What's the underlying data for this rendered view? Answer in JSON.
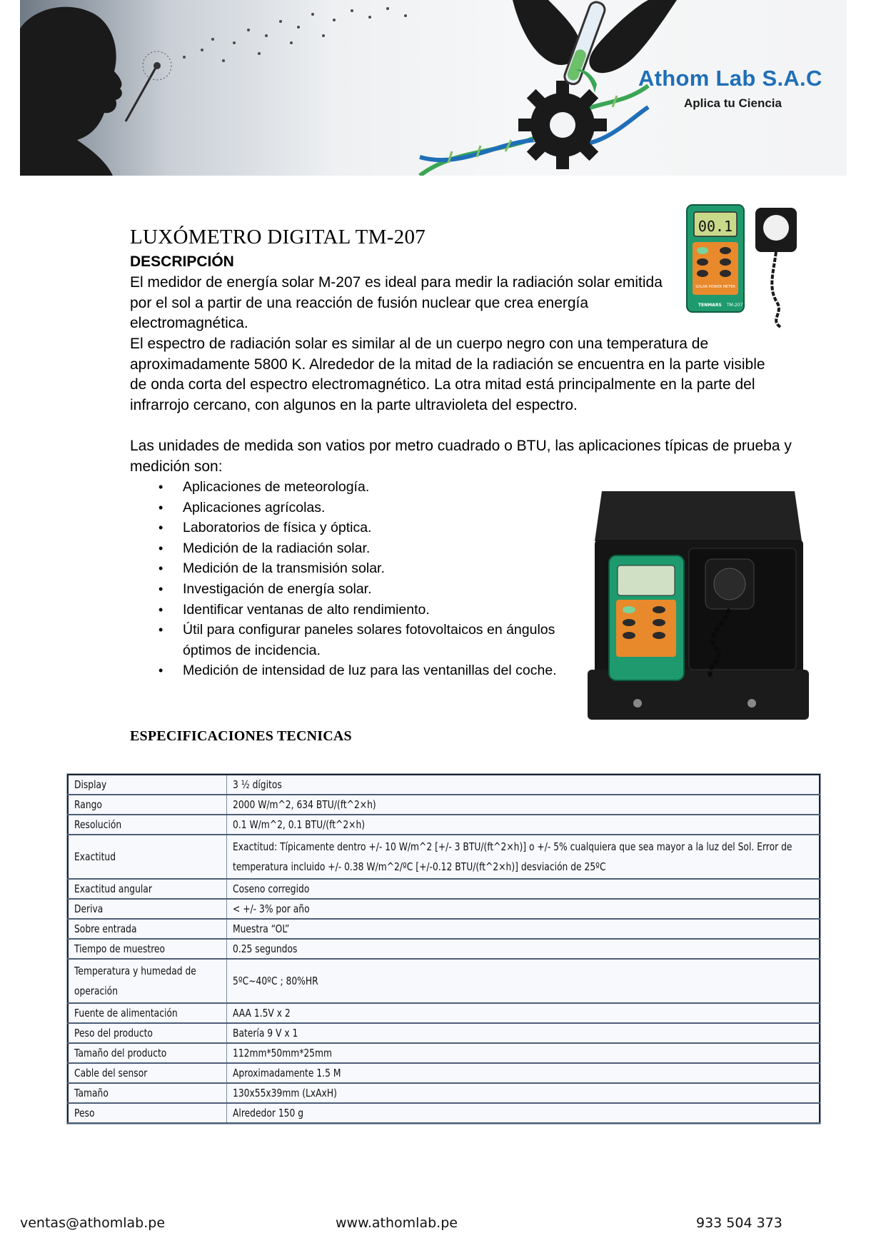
{
  "header": {
    "brand_name": "Athom Lab S.A.C",
    "slogan": "Aplica tu Ciencia"
  },
  "product": {
    "title": "LUXÓMETRO DIGITAL TM-207",
    "description_heading": "DESCRIPCIÓN",
    "paragraph_1": "El medidor de energía solar M-207 es ideal para medir la radiación solar emitida por el sol a partir de una reacción de fusión nuclear que crea energía electromagnética.",
    "paragraph_2": "El espectro de radiación solar es similar al de un cuerpo negro con una temperatura de aproximadamente 5800 K. Alrededor de la mitad de la radiación se encuentra en la parte visible de onda corta del espectro electromagnético. La otra mitad está principalmente en la parte del infrarrojo cercano, con algunos en la parte ultravioleta del espectro.",
    "paragraph_3": "Las unidades de medida son vatios por metro cuadrado o BTU, las aplicaciones típicas de prueba y medición son:",
    "applications": [
      "Aplicaciones de meteorología.",
      "Aplicaciones agrícolas.",
      "Laboratorios de física y óptica.",
      "Medición de la radiación solar.",
      "Medición de la transmisión solar.",
      "Investigación de energía solar.",
      "Identificar ventanas de alto rendimiento.",
      "Útil para configurar paneles solares fotovoltaicos en ángulos óptimos de incidencia.",
      "Medición de intensidad de luz para las ventanillas del coche."
    ],
    "meter_brand": "TENMARS",
    "meter_model": "TM-207",
    "meter_label": "SOLAR POWER METER",
    "display_reading": "00.1"
  },
  "specs": {
    "heading": "ESPECIFICACIONES TECNICAS",
    "rows": [
      {
        "key": "Display",
        "value": "3 ½ dígitos"
      },
      {
        "key": "Rango",
        "value": "2000 W/m^2, 634 BTU/(ft^2×h)"
      },
      {
        "key": "Resolución",
        "value": "0.1 W/m^2, 0.1 BTU/(ft^2×h)"
      },
      {
        "key": "Exactitud",
        "value": "Exactitud: Típicamente dentro +/- 10 W/m^2 [+/- 3 BTU/(ft^2×h)] o +/- 5% cualquiera que sea mayor a la luz del Sol. Error de temperatura incluido +/- 0.38 W/m^2/ºC [+/-0.12 BTU/(ft^2×h)] desviación de 25ºC"
      },
      {
        "key": "Exactitud angular",
        "value": "Coseno corregido"
      },
      {
        "key": "Deriva",
        "value": "< +/- 3% por año"
      },
      {
        "key": "Sobre entrada",
        "value": "Muestra “OL”"
      },
      {
        "key": "Tiempo de muestreo",
        "value": "0.25 segundos"
      },
      {
        "key": "Temperatura y humedad de operación",
        "value": "5ºC~40ºC ; 80%HR"
      },
      {
        "key": "Fuente de alimentación",
        "value": "AAA 1.5V x 2"
      },
      {
        "key": "Peso del producto",
        "value": "Batería 9 V x 1"
      },
      {
        "key": "Tamaño del producto",
        "value": "112mm*50mm*25mm"
      },
      {
        "key": "Cable del sensor",
        "value": "Aproximadamente 1.5 M"
      },
      {
        "key": "Tamaño",
        "value": "130x55x39mm (LxAxH)"
      },
      {
        "key": "Peso",
        "value": "Alrededor 150 g"
      }
    ]
  },
  "footer": {
    "email": "ventas@athomlab.pe",
    "website": "www.athomlab.pe",
    "phone": "933 504 373"
  },
  "colors": {
    "brand_blue": "#1f6fb8",
    "meter_green": "#1e9a6e",
    "keypad_orange": "#e8892c",
    "table_border": "#1b2430"
  }
}
